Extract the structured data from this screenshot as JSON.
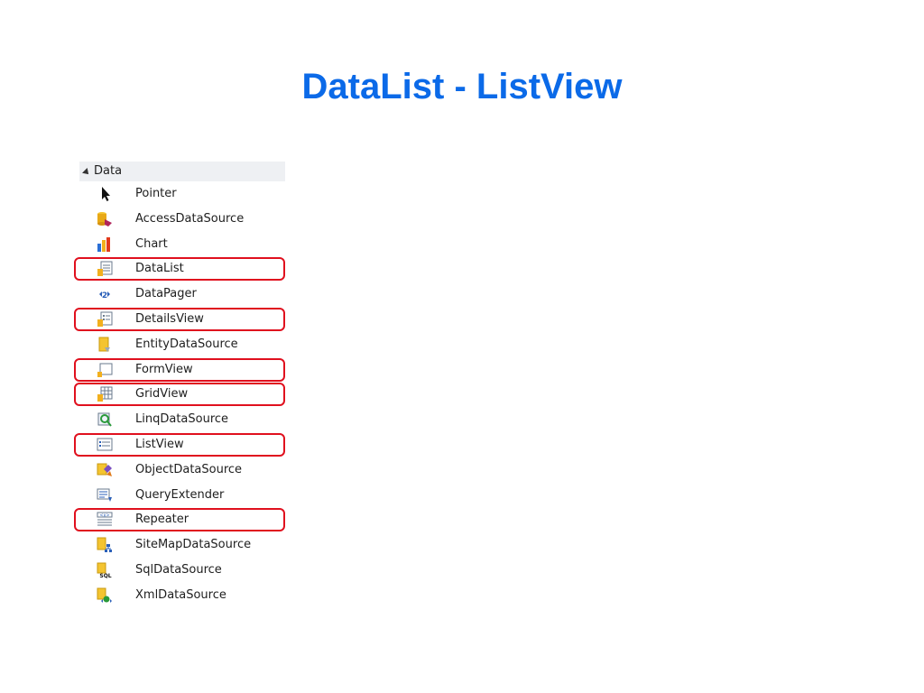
{
  "slide": {
    "title": "DataList - ListView"
  },
  "toolbox": {
    "section_label": "Data",
    "highlight_color": "#e0101e",
    "title_color": "#0b6ae8",
    "items": [
      {
        "label": "Pointer",
        "icon": "pointer-icon",
        "highlighted": false
      },
      {
        "label": "AccessDataSource",
        "icon": "access-datasource-icon",
        "highlighted": false
      },
      {
        "label": "Chart",
        "icon": "chart-icon",
        "highlighted": false
      },
      {
        "label": "DataList",
        "icon": "datalist-icon",
        "highlighted": true
      },
      {
        "label": "DataPager",
        "icon": "datapager-icon",
        "highlighted": false
      },
      {
        "label": "DetailsView",
        "icon": "detailsview-icon",
        "highlighted": true
      },
      {
        "label": "EntityDataSource",
        "icon": "entity-datasource-icon",
        "highlighted": false
      },
      {
        "label": "FormView",
        "icon": "formview-icon",
        "highlighted": true
      },
      {
        "label": "GridView",
        "icon": "gridview-icon",
        "highlighted": true
      },
      {
        "label": "LinqDataSource",
        "icon": "linq-datasource-icon",
        "highlighted": false
      },
      {
        "label": "ListView",
        "icon": "listview-icon",
        "highlighted": true
      },
      {
        "label": "ObjectDataSource",
        "icon": "object-datasource-icon",
        "highlighted": false
      },
      {
        "label": "QueryExtender",
        "icon": "query-extender-icon",
        "highlighted": false
      },
      {
        "label": "Repeater",
        "icon": "repeater-icon",
        "highlighted": true
      },
      {
        "label": "SiteMapDataSource",
        "icon": "sitemap-datasource-icon",
        "highlighted": false
      },
      {
        "label": "SqlDataSource",
        "icon": "sql-datasource-icon",
        "highlighted": false
      },
      {
        "label": "XmlDataSource",
        "icon": "xml-datasource-icon",
        "highlighted": false
      }
    ]
  }
}
